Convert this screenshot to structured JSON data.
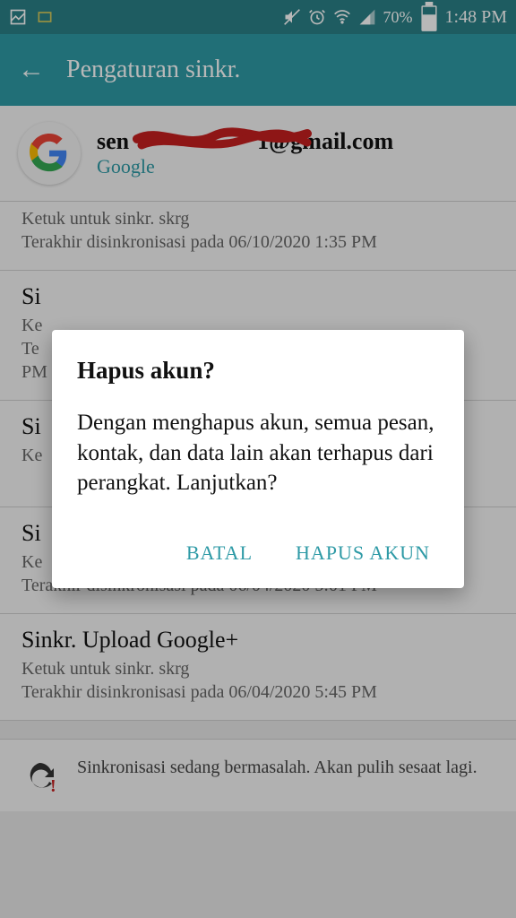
{
  "statusbar": {
    "battery_pct": "70%",
    "time": "1:48 PM"
  },
  "header": {
    "title": "Pengaturan sinkr."
  },
  "account": {
    "email_prefix": "sen",
    "email_suffix": "1@gmail.com",
    "provider": "Google"
  },
  "sync_items": [
    {
      "title": "",
      "sub1": "Ketuk untuk sinkr. skrg",
      "sub2": "Terakhir disinkronisasi pada 06/10/2020 1:35 PM"
    },
    {
      "title": "Si",
      "sub1": "Ke",
      "sub2": "Te",
      "sub3": "PM"
    },
    {
      "title": "Si",
      "sub1": "Ke",
      "sub2": ""
    },
    {
      "title": "Si",
      "sub1": "Ke",
      "sub2": "Terakhir disinkronisasi pada 06/04/2020 5:01 PM"
    },
    {
      "title": "Sinkr. Upload Google+",
      "sub1": "Ketuk untuk sinkr. skrg",
      "sub2": "Terakhir disinkronisasi pada 06/04/2020 5:45 PM"
    }
  ],
  "warning": {
    "text": "Sinkronisasi sedang bermasalah. Akan pulih sesaat lagi."
  },
  "dialog": {
    "title": "Hapus akun?",
    "body": "Dengan menghapus akun, semua pesan, kontak, dan data lain akan terhapus dari perangkat. Lanjutkan?",
    "cancel": "BATAL",
    "confirm": "HAPUS AKUN"
  }
}
